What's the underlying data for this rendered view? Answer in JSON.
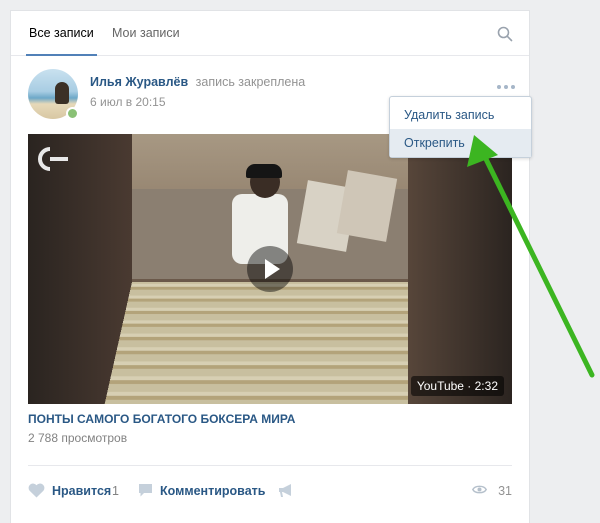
{
  "tabs": [
    {
      "label": "Все записи",
      "active": true
    },
    {
      "label": "Мои записи",
      "active": false
    }
  ],
  "post": {
    "author": "Илья Журавлёв",
    "pinned_note": "запись закреплена",
    "date": "6 июл в 20:15",
    "video": {
      "duration": "YouTube · 2:32",
      "title": "ПОНТЫ САМОГО БОГАТОГО БОКСЕРА МИРА",
      "views": "2 788 просмотров"
    },
    "actions": {
      "like_label": "Нравится",
      "like_count": "1",
      "comment_label": "Комментировать",
      "views_count": "31"
    }
  },
  "menu": {
    "items": [
      "Удалить запись",
      "Открепить"
    ]
  },
  "colors": {
    "link": "#2a5885",
    "accent": "#5181b8",
    "arrow": "#3cb521",
    "online": "#8ac176"
  }
}
